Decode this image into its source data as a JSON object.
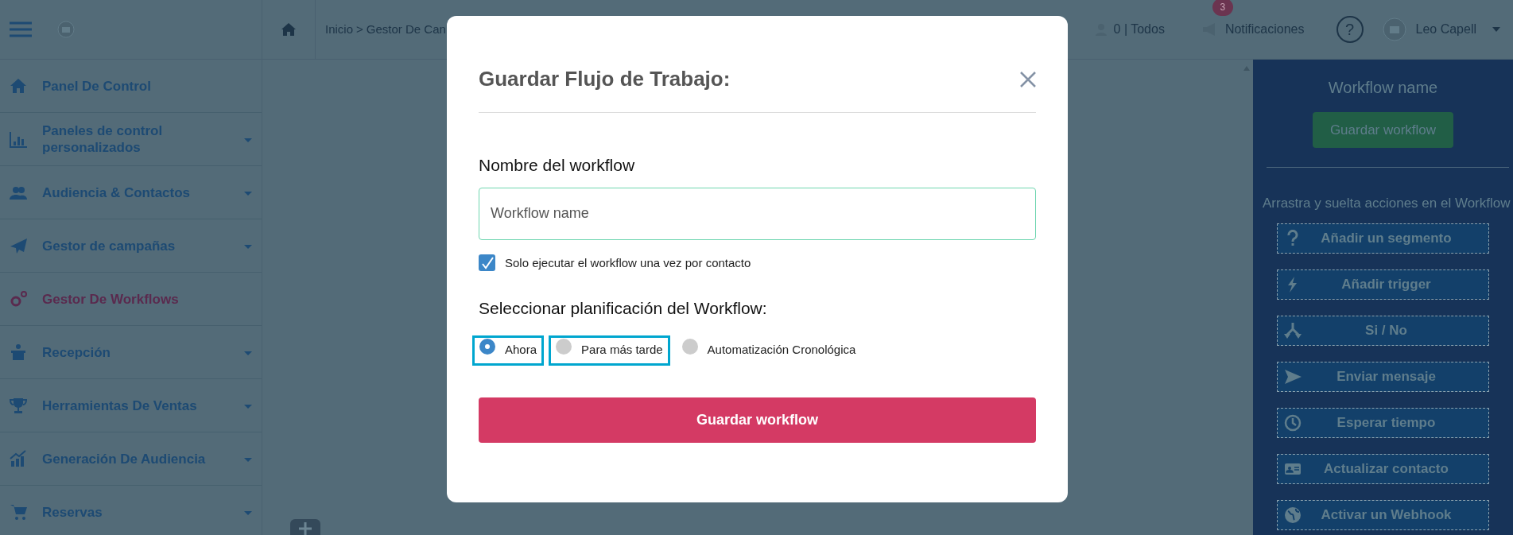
{
  "top_bar": {
    "breadcrumb": {
      "home": "Inicio",
      "separator": ">",
      "current": "Gestor De Can"
    },
    "contacts": "0 | Todos",
    "notifications": {
      "count": "3",
      "label": "Notificaciones"
    },
    "help": "?",
    "user": "Leo Capell"
  },
  "sidebar": {
    "items": [
      {
        "label": "Panel De Control",
        "expandable": false,
        "selected": false
      },
      {
        "label": "Paneles de control personalizados",
        "expandable": true,
        "selected": false
      },
      {
        "label": "Audiencia & Contactos",
        "expandable": true,
        "selected": false
      },
      {
        "label": "Gestor de campañas",
        "expandable": true,
        "selected": false
      },
      {
        "label": "Gestor De Workflows",
        "expandable": false,
        "selected": true
      },
      {
        "label": "Recepción",
        "expandable": true,
        "selected": false
      },
      {
        "label": "Herramientas De Ventas",
        "expandable": true,
        "selected": false
      },
      {
        "label": "Generación De Audiencia",
        "expandable": true,
        "selected": false
      },
      {
        "label": "Reservas",
        "expandable": true,
        "selected": false
      }
    ]
  },
  "right_panel": {
    "title": "Workflow name",
    "save_button": "Guardar workflow",
    "hint": "Arrastra y suelta acciones en el Workflow",
    "actions": [
      "Añadir un segmento",
      "Añadir trigger",
      "Si / No",
      "Enviar mensaje",
      "Esperar tiempo",
      "Actualizar contacto",
      "Activar un Webhook"
    ]
  },
  "modal": {
    "title": "Guardar Flujo de Trabajo:",
    "name_label": "Nombre del workflow",
    "name_field": {
      "value": "Workflow name"
    },
    "once_per_contact": {
      "label": "Solo ejecutar el workflow una vez por contacto",
      "checked": true
    },
    "schedule_label": "Seleccionar planificación del Workflow:",
    "schedule_options": [
      {
        "label": "Ahora",
        "selected": true,
        "outlined": true
      },
      {
        "label": "Para más tarde",
        "selected": false,
        "outlined": true
      },
      {
        "label": "Automatización Cronológica",
        "selected": false,
        "outlined": false
      }
    ],
    "save_button": "Guardar workflow"
  }
}
